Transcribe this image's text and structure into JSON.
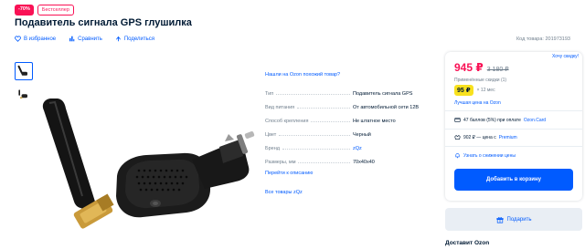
{
  "badges": {
    "sale": "-70%",
    "bestseller": "Бестселлер"
  },
  "product": {
    "title": "Подавитель сигнала GPS глушилка",
    "code": "Код товара: 201973193"
  },
  "actions": {
    "favorite": "В избранное",
    "compare": "Сравнить",
    "share": "Поделиться"
  },
  "found_cheaper": "Нашли на Ozon похожий товар?",
  "specs": [
    {
      "key": "Тип",
      "value": "Подавитель сигнала GPS"
    },
    {
      "key": "Вид питания",
      "value": "От автомобильной сети 12В"
    },
    {
      "key": "Способ крепления",
      "value": "Не штатное место"
    },
    {
      "key": "Цвет",
      "value": "Черный"
    },
    {
      "key": "Бренд",
      "value": "zQz"
    },
    {
      "key": "Размеры, мм",
      "value": "70x40x40"
    }
  ],
  "go_description": "Перейти к описанию",
  "all_goods": "Все товары zQz",
  "price_card": {
    "cheaper_link": "Хочу скидку!",
    "price": "945 ₽",
    "old_price": "3 180 ₽",
    "discounts_label": "Применённые скидки (1)",
    "card_price": "95 ₽",
    "card_note": "× 12 мес",
    "best_price": "Лучшая цена на Ozon",
    "bonus_prefix": "47 баллов (5%) при оплате",
    "bonus_link": "Ozon.Card",
    "premium_prefix": "902 ₽ — цена с",
    "premium_link": "Premium",
    "notify": "Узнать о снижении цены",
    "cart_button": "Добавить в корзину"
  },
  "gift_button": "Подарить",
  "delivery_title": "Доставит Ozon",
  "colors": {
    "accent": "#005bff",
    "sale": "#f91155",
    "card_price_bg": "#f8e11e"
  },
  "icons": [
    "heart-icon",
    "compare-icon",
    "share-icon",
    "gift-icon",
    "bonus-card-icon",
    "premium-icon",
    "bell-icon"
  ]
}
